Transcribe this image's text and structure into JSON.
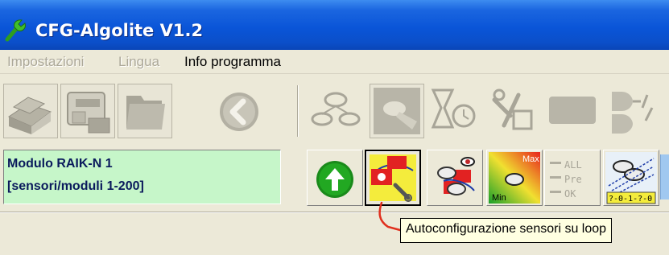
{
  "window": {
    "title": "CFG-Algolite V1.2",
    "icon": "wrench-icon"
  },
  "menu": {
    "items": [
      {
        "label": "Impostazioni",
        "enabled": false
      },
      {
        "label": "Lingua",
        "enabled": false
      },
      {
        "label": "Info programma",
        "enabled": true
      }
    ]
  },
  "toolbar": {
    "buttons": [
      {
        "icon": "stack-icon",
        "enabled": false
      },
      {
        "icon": "module-config-icon",
        "enabled": false
      },
      {
        "icon": "folders-icon",
        "enabled": false
      },
      {
        "icon": "back-arrow-icon",
        "enabled": false
      },
      {
        "icon": "sensors-tree-icon",
        "enabled": false
      },
      {
        "icon": "sensor-hand-icon",
        "enabled": false
      },
      {
        "icon": "hourglass-timer-icon",
        "enabled": false
      },
      {
        "icon": "tools-icon",
        "enabled": false
      },
      {
        "icon": "blank-panel-icon",
        "enabled": false
      },
      {
        "icon": "logic-gates-icon",
        "enabled": false
      }
    ]
  },
  "module": {
    "line1": "Modulo RAIK-N 1",
    "line2": "[sensori/moduli 1-200]"
  },
  "buttons2": [
    {
      "icon": "upload-arrow-icon"
    },
    {
      "icon": "autoconfig-sensors-icon",
      "pressed": true
    },
    {
      "icon": "sensor-eye-icon"
    },
    {
      "icon": "max-min-gradient-icon",
      "labels": {
        "max": "Max",
        "min": "Min"
      }
    },
    {
      "icon": "all-pre-ok-icon",
      "labels": [
        "ALL",
        "Pre",
        "OK"
      ]
    },
    {
      "icon": "sensor-grid-icon",
      "label": "?-0-1-?-0"
    }
  ],
  "tooltip": {
    "text": "Autoconfigurazione sensori su loop"
  },
  "colors": {
    "titlebar": "#0a55d8",
    "module_panel": "#c6f6c9",
    "tooltip_bg": "#ffffe1",
    "callout": "#e0301e"
  }
}
